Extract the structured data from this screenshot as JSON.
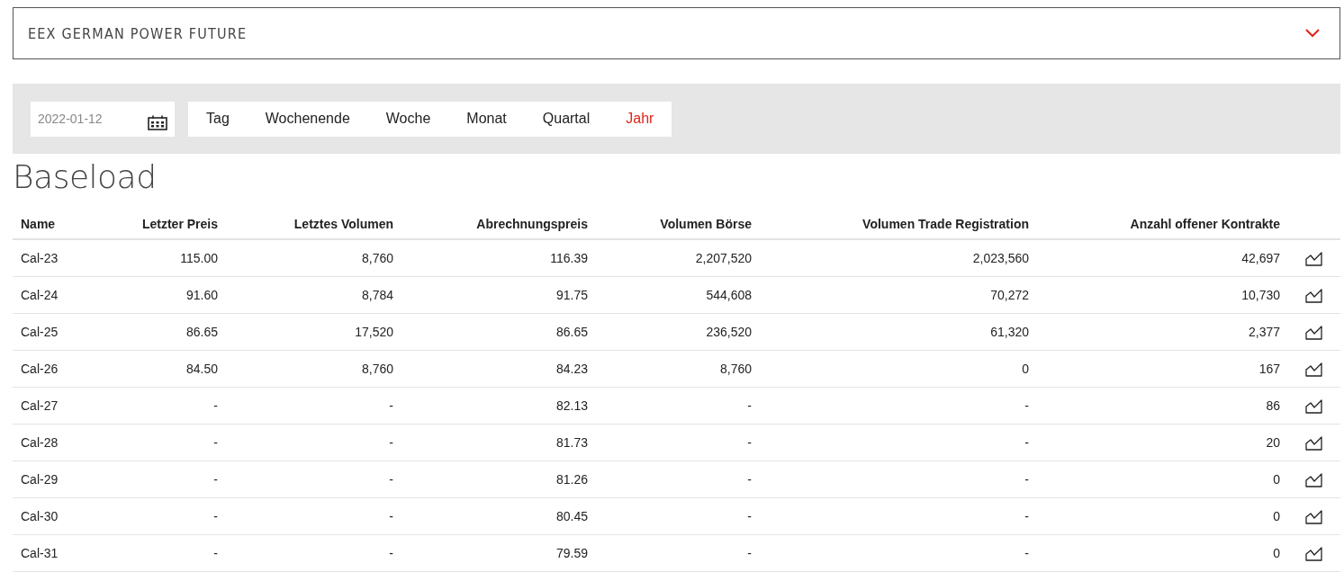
{
  "panel": {
    "title": "EEX GERMAN POWER FUTURE",
    "expanded": false
  },
  "date_field": {
    "value": "2022-01-12"
  },
  "tabs": [
    {
      "label": "Tag",
      "selected": false
    },
    {
      "label": "Wochenende",
      "selected": false
    },
    {
      "label": "Woche",
      "selected": false
    },
    {
      "label": "Monat",
      "selected": false
    },
    {
      "label": "Quartal",
      "selected": false
    },
    {
      "label": "Jahr",
      "selected": true
    }
  ],
  "heading": "Baseload",
  "table": {
    "columns": [
      "Name",
      "Letzter Preis",
      "Letztes Volumen",
      "Abrechnungspreis",
      "Volumen Börse",
      "Volumen Trade Registration",
      "Anzahl offener Kontrakte"
    ],
    "rows": [
      [
        "Cal-23",
        "115.00",
        "8,760",
        "116.39",
        "2,207,520",
        "2,023,560",
        "42,697"
      ],
      [
        "Cal-24",
        "91.60",
        "8,784",
        "91.75",
        "544,608",
        "70,272",
        "10,730"
      ],
      [
        "Cal-25",
        "86.65",
        "17,520",
        "86.65",
        "236,520",
        "61,320",
        "2,377"
      ],
      [
        "Cal-26",
        "84.50",
        "8,760",
        "84.23",
        "8,760",
        "0",
        "167"
      ],
      [
        "Cal-27",
        "-",
        "-",
        "82.13",
        "-",
        "-",
        "86"
      ],
      [
        "Cal-28",
        "-",
        "-",
        "81.73",
        "-",
        "-",
        "20"
      ],
      [
        "Cal-29",
        "-",
        "-",
        "81.26",
        "-",
        "-",
        "0"
      ],
      [
        "Cal-30",
        "-",
        "-",
        "80.45",
        "-",
        "-",
        "0"
      ],
      [
        "Cal-31",
        "-",
        "-",
        "79.59",
        "-",
        "-",
        "0"
      ]
    ]
  }
}
